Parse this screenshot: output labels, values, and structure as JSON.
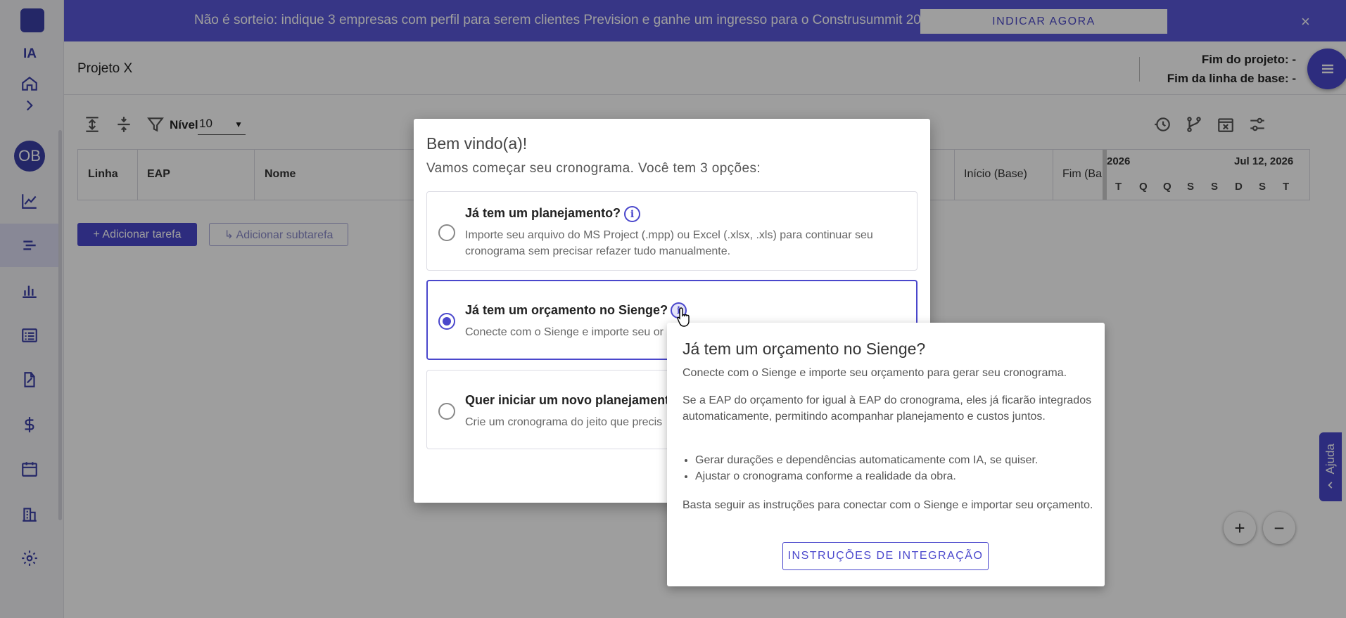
{
  "banner": {
    "text": "Não é sorteio: indique 3 empresas com perfil para serem clientes Prevision e ganhe um ingresso para o Construsummit 2027.",
    "cta_label": "INDICAR AGORA",
    "close": "×"
  },
  "sidebar": {
    "ia_label": "IA",
    "avatar_initials": "OB",
    "items": [
      "home-icon",
      "chevron-right-icon",
      "line-chart-icon",
      "schedule-icon",
      "bar-chart-icon",
      "list-icon",
      "document-edit-icon",
      "dollar-icon",
      "calendar-icon",
      "building-icon",
      "gear-icon"
    ]
  },
  "header": {
    "project_name": "Projeto X",
    "fim_projeto": "Fim do projeto: -",
    "fim_linha_base": "Fim da linha de base: -"
  },
  "toolbar": {
    "nivel_label": "Nível",
    "nivel_value": "10"
  },
  "table": {
    "columns": [
      "Linha",
      "EAP",
      "Nome",
      "Início (Base)",
      "Fim (Ba"
    ],
    "gantt_months": [
      "2026",
      "Jul 12, 2026"
    ],
    "gantt_days": [
      "T",
      "Q",
      "Q",
      "S",
      "S",
      "D",
      "S",
      "T"
    ]
  },
  "actions": {
    "add_task": "+ Adicionar tarefa",
    "add_subtask": "↳ Adicionar subtarefa"
  },
  "zoom": {
    "in": "+",
    "out": "−"
  },
  "help_tab": {
    "label": "Ajuda"
  },
  "modal": {
    "title": "Bem vindo(a)!",
    "subtitle": "Vamos começar seu cronograma. Você tem 3 opções:",
    "options": [
      {
        "title": "Já tem um planejamento?",
        "description": "Importe seu arquivo do MS Project (.mpp) ou Excel (.xlsx, .xls) para continuar seu cronograma sem precisar refazer tudo manualmente."
      },
      {
        "title": "Já tem um orçamento no Sienge?",
        "description": "Conecte com o Sienge e importe seu or"
      },
      {
        "title": "Quer iniciar um novo planejamento",
        "description": "Crie um cronograma do jeito que precis"
      }
    ]
  },
  "popover": {
    "title": "Já tem um orçamento no Sienge?",
    "p1": "Conecte com o Sienge e importe seu orçamento para gerar seu cronograma.",
    "p2": "Se a EAP do orçamento for igual à EAP do cronograma, eles já ficarão integrados automaticamente, permitindo acompanhar planejamento e custos juntos.",
    "bullets": [
      "Gerar durações e dependências automaticamente com IA, se quiser.",
      "Ajustar o cronograma conforme a realidade da obra."
    ],
    "p3": "Basta seguir as instruções para conectar com o Sienge e importar seu orçamento.",
    "button": "INSTRUÇÕES DE INTEGRAÇÃO"
  },
  "colors": {
    "primary": "#4a47cc",
    "banner": "#5a57d9"
  }
}
